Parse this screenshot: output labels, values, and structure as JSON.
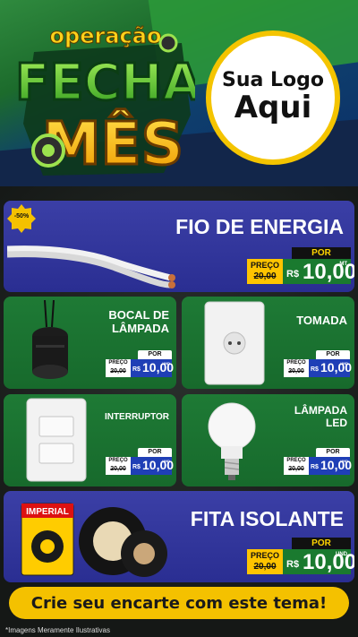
{
  "header": {
    "campaign": {
      "line1": "operação",
      "line2": "FECHA",
      "line3": "MÊS"
    },
    "logo_placeholder": {
      "line1": "Sua Logo",
      "line2": "Aqui"
    }
  },
  "products": [
    {
      "name": "FIO DE ENERGIA",
      "badge": "-50%",
      "label_por": "POR",
      "label_preco": "PREÇO",
      "old_price": "20,00",
      "currency": "R$",
      "price": "10,00",
      "unit": "MT"
    },
    {
      "name": "BOCAL DE LÂMPADA",
      "label_por": "POR",
      "label_preco": "PREÇO",
      "old_price": "20,00",
      "currency": "R$",
      "price": "10,00",
      "unit": "UND"
    },
    {
      "name": "TOMADA",
      "label_por": "POR",
      "label_preco": "PREÇO",
      "old_price": "20,00",
      "currency": "R$",
      "price": "10,00",
      "unit": "UND"
    },
    {
      "name": "INTERRUPTOR",
      "label_por": "POR",
      "label_preco": "PREÇO",
      "old_price": "20,00",
      "currency": "R$",
      "price": "10,00",
      "unit": "UND"
    },
    {
      "name": "LÂMPADA LED",
      "label_por": "POR",
      "label_preco": "PREÇO",
      "old_price": "20,00",
      "currency": "R$",
      "price": "10,00",
      "unit": "UND"
    },
    {
      "name": "FITA ISOLANTE",
      "label_por": "POR",
      "label_preco": "PREÇO",
      "old_price": "20,00",
      "currency": "R$",
      "price": "10,00",
      "unit": "UND",
      "package_text": "IMPERIAL"
    }
  ],
  "cta": "Crie seu encarte com este tema!",
  "footnote": "*Imagens Meramente Ilustrativas",
  "colors": {
    "accent_yellow": "#f4c100",
    "card_blue": "#2f34a0",
    "card_green": "#1c7631",
    "price_green": "#1a7a2f",
    "price_blue": "#1f3fb6"
  }
}
